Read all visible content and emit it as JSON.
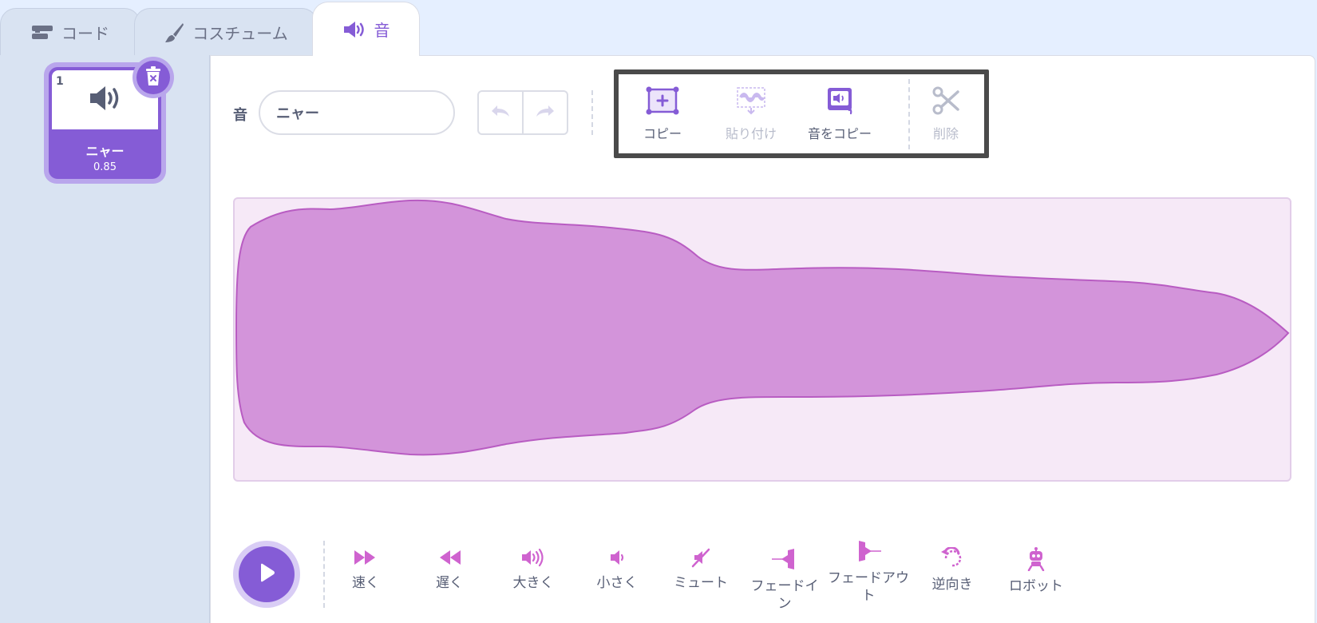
{
  "tabs": {
    "code": "コード",
    "costume": "コスチューム",
    "sound": "音"
  },
  "sound_list": {
    "items": [
      {
        "index": "1",
        "name": "ニャー",
        "duration": "0.85"
      }
    ]
  },
  "editor": {
    "sound_label": "音",
    "sound_name": "ニャー",
    "edit_buttons": {
      "copy": "コピー",
      "paste": "貼り付け",
      "copy_to_new": "音をコピー",
      "delete": "削除"
    }
  },
  "effects": {
    "faster": "速く",
    "slower": "遅く",
    "louder": "大きく",
    "softer": "小さく",
    "mute": "ミュート",
    "fade_in": "フェードイン",
    "fade_out": "フェードアウト",
    "reverse": "逆向き",
    "robot": "ロボット"
  },
  "colors": {
    "accent": "#855cd6",
    "wave_fill": "#d394da",
    "wave_stroke": "#b85cc2",
    "wave_bg": "#f6e9f7"
  }
}
